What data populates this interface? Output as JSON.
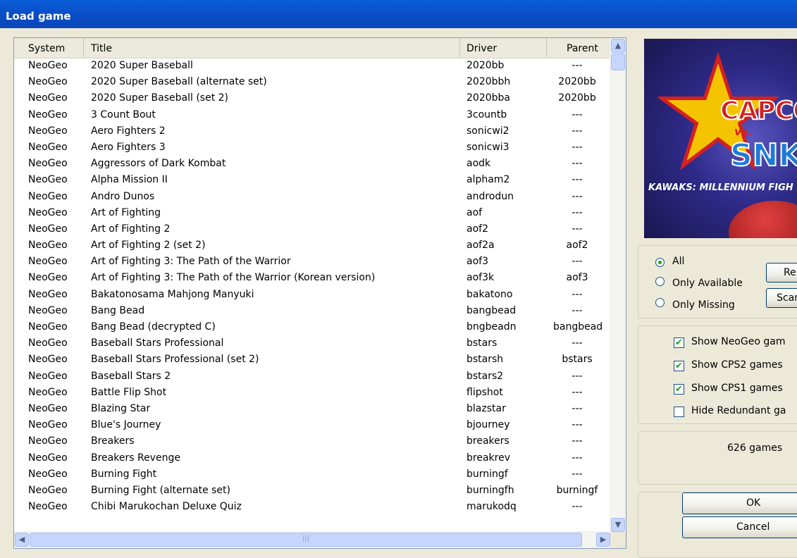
{
  "window": {
    "title": "Load game"
  },
  "columns": {
    "system": "System",
    "title": "Title",
    "driver": "Driver",
    "parent": "Parent"
  },
  "games": [
    {
      "system": "NeoGeo",
      "title": "2020 Super Baseball",
      "driver": "2020bb",
      "parent": "---"
    },
    {
      "system": "NeoGeo",
      "title": "2020 Super Baseball (alternate set)",
      "driver": "2020bbh",
      "parent": "2020bb"
    },
    {
      "system": "NeoGeo",
      "title": "2020 Super Baseball (set 2)",
      "driver": "2020bba",
      "parent": "2020bb"
    },
    {
      "system": "NeoGeo",
      "title": "3 Count Bout",
      "driver": "3countb",
      "parent": "---"
    },
    {
      "system": "NeoGeo",
      "title": "Aero Fighters 2",
      "driver": "sonicwi2",
      "parent": "---"
    },
    {
      "system": "NeoGeo",
      "title": "Aero Fighters 3",
      "driver": "sonicwi3",
      "parent": "---"
    },
    {
      "system": "NeoGeo",
      "title": "Aggressors of Dark Kombat",
      "driver": "aodk",
      "parent": "---"
    },
    {
      "system": "NeoGeo",
      "title": "Alpha Mission II",
      "driver": "alpham2",
      "parent": "---"
    },
    {
      "system": "NeoGeo",
      "title": "Andro Dunos",
      "driver": "androdun",
      "parent": "---"
    },
    {
      "system": "NeoGeo",
      "title": "Art of Fighting",
      "driver": "aof",
      "parent": "---"
    },
    {
      "system": "NeoGeo",
      "title": "Art of Fighting 2",
      "driver": "aof2",
      "parent": "---"
    },
    {
      "system": "NeoGeo",
      "title": "Art of Fighting 2 (set 2)",
      "driver": "aof2a",
      "parent": "aof2"
    },
    {
      "system": "NeoGeo",
      "title": "Art of Fighting 3: The Path of the Warrior",
      "driver": "aof3",
      "parent": "---"
    },
    {
      "system": "NeoGeo",
      "title": "Art of Fighting 3: The Path of the Warrior (Korean version)",
      "driver": "aof3k",
      "parent": "aof3"
    },
    {
      "system": "NeoGeo",
      "title": "Bakatonosama Mahjong Manyuki",
      "driver": "bakatono",
      "parent": "---"
    },
    {
      "system": "NeoGeo",
      "title": "Bang Bead",
      "driver": "bangbead",
      "parent": "---"
    },
    {
      "system": "NeoGeo",
      "title": "Bang Bead (decrypted C)",
      "driver": "bngbeadn",
      "parent": "bangbead"
    },
    {
      "system": "NeoGeo",
      "title": "Baseball Stars Professional",
      "driver": "bstars",
      "parent": "---"
    },
    {
      "system": "NeoGeo",
      "title": "Baseball Stars Professional (set 2)",
      "driver": "bstarsh",
      "parent": "bstars"
    },
    {
      "system": "NeoGeo",
      "title": "Baseball Stars 2",
      "driver": "bstars2",
      "parent": "---"
    },
    {
      "system": "NeoGeo",
      "title": "Battle Flip Shot",
      "driver": "flipshot",
      "parent": "---"
    },
    {
      "system": "NeoGeo",
      "title": "Blazing Star",
      "driver": "blazstar",
      "parent": "---"
    },
    {
      "system": "NeoGeo",
      "title": "Blue's Journey",
      "driver": "bjourney",
      "parent": "---"
    },
    {
      "system": "NeoGeo",
      "title": "Breakers",
      "driver": "breakers",
      "parent": "---"
    },
    {
      "system": "NeoGeo",
      "title": "Breakers Revenge",
      "driver": "breakrev",
      "parent": "---"
    },
    {
      "system": "NeoGeo",
      "title": "Burning Fight",
      "driver": "burningf",
      "parent": "---"
    },
    {
      "system": "NeoGeo",
      "title": "Burning Fight (alternate set)",
      "driver": "burningfh",
      "parent": "burningf"
    },
    {
      "system": "NeoGeo",
      "title": "Chibi Marukochan Deluxe Quiz",
      "driver": "marukodq",
      "parent": "---"
    }
  ],
  "preview": {
    "logo_capcom": "CAPCO",
    "logo_vs": "vs.",
    "logo_snk": "SNK",
    "logo_sub": "KAWAKS: MILLENNIUM FIGH",
    "accent": "#2e2a88"
  },
  "filter": {
    "all": "All",
    "only_available": "Only Available",
    "only_missing": "Only Missing",
    "selected": "All",
    "rescan_label": "Re",
    "scan_label": "Scan"
  },
  "options": {
    "show_neogeo": "Show NeoGeo gam",
    "show_cps2": "Show CPS2 games",
    "show_cps1": "Show CPS1 games",
    "hide_redundant": "Hide Redundant ga"
  },
  "count": "626 games",
  "buttons": {
    "ok": "OK",
    "cancel": "Cancel"
  }
}
